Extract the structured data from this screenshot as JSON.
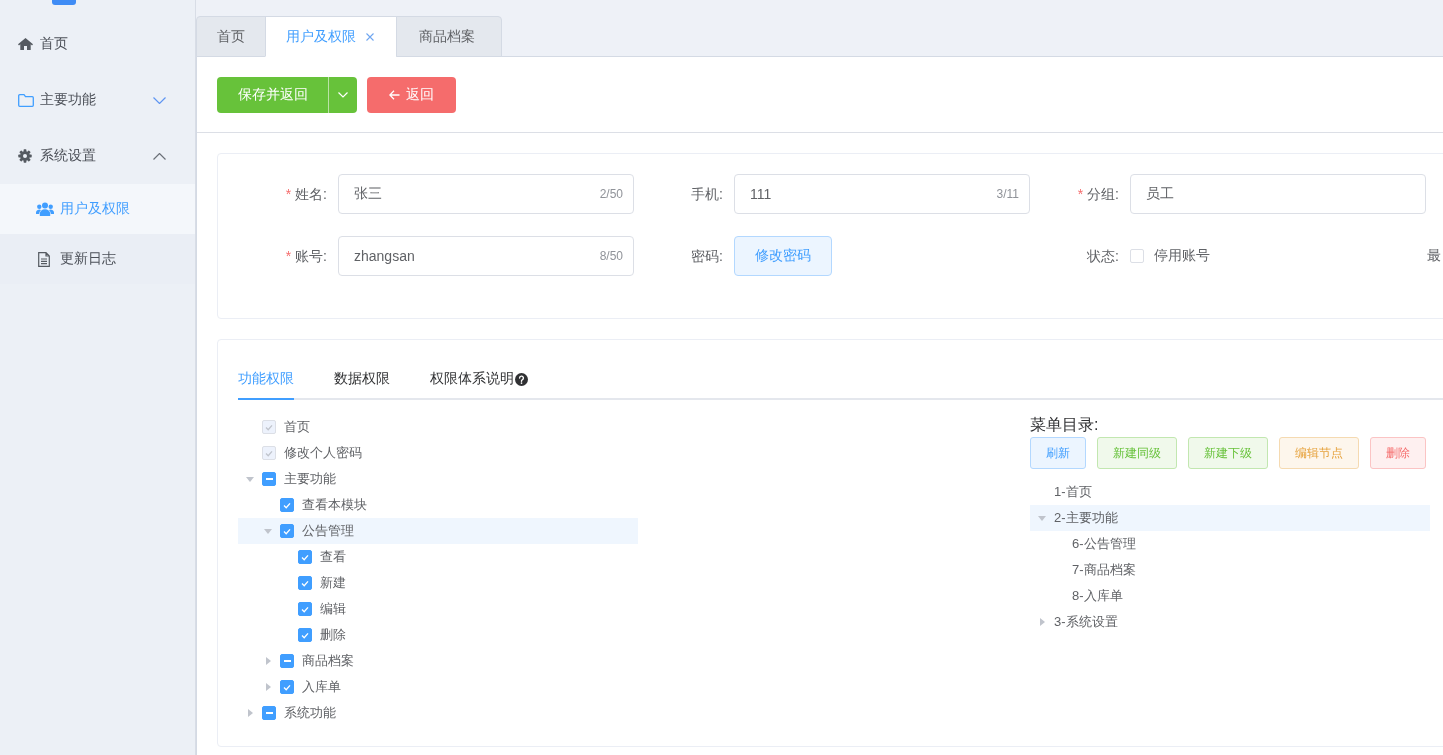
{
  "sidebar": {
    "items": [
      {
        "label": "首页",
        "selected": false
      },
      {
        "label": "主要功能",
        "selected": false,
        "expanded": false
      },
      {
        "label": "系统设置",
        "selected": false,
        "expanded": true,
        "children": [
          {
            "label": "用户及权限",
            "selected": true
          },
          {
            "label": "更新日志",
            "selected": false
          }
        ]
      }
    ]
  },
  "tabs": [
    {
      "label": "首页",
      "selected": false,
      "closable": false
    },
    {
      "label": "用户及权限",
      "selected": true,
      "closable": true
    },
    {
      "label": "商品档案",
      "selected": false,
      "closable": false
    }
  ],
  "toolbar": {
    "buttons": [
      {
        "kind": "split",
        "label": "保存并返回"
      },
      {
        "kind": "back",
        "label": "返回"
      }
    ]
  },
  "form": {
    "rows": [
      [
        {
          "kind": "text",
          "required_mark": "*",
          "label": "姓名:",
          "value": "张三",
          "counter": "2/50"
        },
        {
          "kind": "text",
          "label": "手机:",
          "value": "111",
          "counter": "3/11"
        },
        {
          "kind": "text",
          "required_mark": "*",
          "label": "分组:",
          "value": "员工"
        }
      ],
      [
        {
          "kind": "text",
          "required_mark": "*",
          "label": "账号:",
          "value": "zhangsan",
          "counter": "8/50"
        },
        {
          "kind": "button",
          "label": "密码:",
          "button": "修改密码"
        },
        {
          "kind": "checkbox",
          "label": "状态:",
          "option": "停用账号",
          "checked": false
        },
        {
          "kind": "cut",
          "label": "最"
        }
      ]
    ]
  },
  "permissions": {
    "tabs": [
      {
        "label": "功能权限",
        "selected": true,
        "help": false
      },
      {
        "label": "数据权限",
        "selected": false,
        "help": false
      },
      {
        "label": "权限体系说明",
        "selected": false,
        "help": true
      }
    ],
    "tree": [
      {
        "label": "首页",
        "checked": true,
        "indeterminate": false,
        "disabled": true,
        "selected": false
      },
      {
        "label": "修改个人密码",
        "checked": true,
        "indeterminate": false,
        "disabled": true,
        "selected": false
      },
      {
        "label": "主要功能",
        "expanded": true,
        "checked": false,
        "indeterminate": true,
        "disabled": false,
        "selected": false,
        "children": [
          {
            "label": "查看本模块",
            "checked": true,
            "indeterminate": false,
            "disabled": false,
            "selected": false
          },
          {
            "label": "公告管理",
            "expanded": true,
            "checked": true,
            "indeterminate": false,
            "disabled": false,
            "selected": true,
            "children": [
              {
                "label": "查看",
                "checked": true,
                "indeterminate": false,
                "disabled": false,
                "selected": false
              },
              {
                "label": "新建",
                "checked": true,
                "indeterminate": false,
                "disabled": false,
                "selected": false
              },
              {
                "label": "编辑",
                "checked": true,
                "indeterminate": false,
                "disabled": false,
                "selected": false
              },
              {
                "label": "删除",
                "checked": true,
                "indeterminate": false,
                "disabled": false,
                "selected": false
              }
            ]
          },
          {
            "label": "商品档案",
            "expanded": false,
            "checked": false,
            "indeterminate": true,
            "disabled": false,
            "selected": false
          },
          {
            "label": "入库单",
            "expanded": false,
            "checked": true,
            "indeterminate": false,
            "disabled": false,
            "selected": false
          }
        ]
      },
      {
        "label": "系统功能",
        "expanded": false,
        "checked": false,
        "indeterminate": true,
        "disabled": false,
        "selected": false
      }
    ],
    "menu_title": "菜单目录:",
    "menu_buttons": [
      {
        "kind": "primary",
        "label": "刷新"
      },
      {
        "kind": "success",
        "label": "新建同级"
      },
      {
        "kind": "success",
        "label": "新建下级"
      },
      {
        "kind": "warning",
        "label": "编辑节点"
      },
      {
        "kind": "danger",
        "label": "删除"
      }
    ],
    "menu_tree": [
      {
        "label": "1-首页",
        "selected": false
      },
      {
        "label": "2-主要功能",
        "expanded": true,
        "selected": true,
        "children": [
          {
            "label": "6-公告管理",
            "selected": false
          },
          {
            "label": "7-商品档案",
            "selected": false
          },
          {
            "label": "8-入库单",
            "selected": false
          }
        ]
      },
      {
        "label": "3-系统设置",
        "expanded": false,
        "selected": false
      }
    ]
  }
}
